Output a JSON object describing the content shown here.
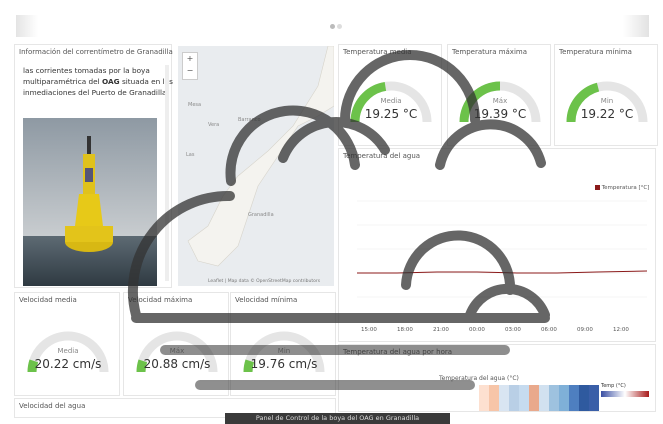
{
  "info": {
    "title": "Información del correntímetro de Granadilla",
    "text_part1": "las corrientes tomadas por la boya multiparamétrica del ",
    "text_bold": "OAG",
    "text_part2": " situada en las inmediaciones del ",
    "text_link": "Puerto de Granadilla",
    "text_end": "."
  },
  "map": {
    "zoom_in": "+",
    "zoom_out": "−",
    "attribution": "Leaflet | Map data © OpenStreetMap contributors"
  },
  "gauges_top": [
    {
      "title": "Temperatura media",
      "label": "Media",
      "value": "19.25 °C",
      "level": 0.45
    },
    {
      "title": "Temperatura máxima",
      "label": "Máx",
      "value": "19.39 °C",
      "level": 0.5
    },
    {
      "title": "Temperatura mínima",
      "label": "Min",
      "value": "19.22 °C",
      "level": 0.42
    }
  ],
  "temp_chart": {
    "title": "Temperatura del agua",
    "legend": "Temperatura [°C]",
    "x_ticks": [
      "15:00",
      "18:00",
      "21:00",
      "00:00",
      "03:00",
      "06:00",
      "09:00",
      "12:00"
    ]
  },
  "gauges_bottom": [
    {
      "title": "Velocidad media",
      "label": "Media",
      "value": "20.22 cm/s",
      "level": 0.1
    },
    {
      "title": "Velocidad máxima",
      "label": "Máx",
      "value": "20.88 cm/s",
      "level": 0.1
    },
    {
      "title": "Velocidad mínima",
      "label": "Min",
      "value": "19.76 cm/s",
      "level": 0.1
    }
  ],
  "velocity_dir": {
    "title": "Velocidad del agua"
  },
  "heatmap": {
    "section_title": "Temperatura del agua por hora",
    "title": "Temperatura del agua (°C)",
    "legend_title": "Temp (°C)"
  },
  "footer": {
    "text": "Panel de Control de la boya del OAG en Granadilla"
  },
  "colors": {
    "gauge_fill": "#6cc24a",
    "gauge_track": "#e5e5e5",
    "line": "#8b1a1a"
  }
}
